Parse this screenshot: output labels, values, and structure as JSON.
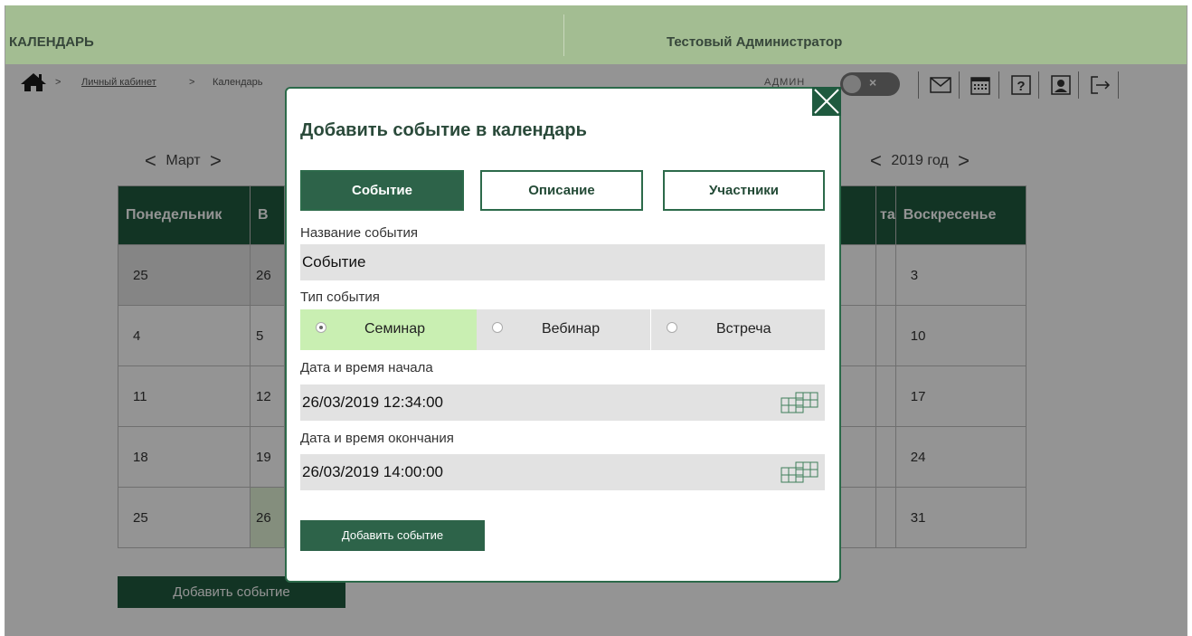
{
  "header": {
    "app_title": "КАЛЕНДАРЬ",
    "user_name": "Тестовый Администратор"
  },
  "breadcrumb": {
    "sep": ">",
    "link": "Личный кабинет",
    "current": "Календарь"
  },
  "admin_toggle": {
    "label": "АДМИН",
    "state_glyph": "×"
  },
  "toolbar_icons": [
    "home-icon",
    "mail-icon",
    "calendar-icon",
    "help-icon",
    "profile-icon",
    "logout-icon"
  ],
  "calendar": {
    "month_label": "Март",
    "year_label": "2019 год",
    "prev_glyph": "<",
    "next_glyph": ">",
    "headers": {
      "mon": "Понедельник",
      "tue_partial": "В",
      "sat_partial": "та",
      "sun": "Воскресенье"
    },
    "rows": [
      {
        "mon": "25",
        "tue": "26",
        "sun": "3"
      },
      {
        "mon": "4",
        "tue": "5",
        "sun": "10"
      },
      {
        "mon": "11",
        "tue": "12",
        "sun": "17"
      },
      {
        "mon": "18",
        "tue": "19",
        "sun": "24"
      },
      {
        "mon": "25",
        "tue": "26",
        "sun": "31"
      }
    ],
    "add_button": "Добавить событие"
  },
  "modal": {
    "title": "Добавить событие в календарь",
    "tabs": [
      {
        "label": "Событие",
        "active": true
      },
      {
        "label": "Описание",
        "active": false
      },
      {
        "label": "Участники",
        "active": false
      }
    ],
    "name_label": "Название события",
    "name_value": "Событие",
    "type_label": "Тип события",
    "type_options": [
      {
        "label": "Семинар",
        "selected": true
      },
      {
        "label": "Вебинар",
        "selected": false
      },
      {
        "label": "Встреча",
        "selected": false
      }
    ],
    "start_label": "Дата и время начала",
    "start_value": "26/03/2019 12:34:00",
    "end_label": "Дата и время окончания",
    "end_value": "26/03/2019 14:00:00",
    "submit_label": "Добавить событие"
  },
  "colors": {
    "header_bg": "#a3bd92",
    "primary": "#2d6349",
    "selected_option": "#c9efb2",
    "field_bg": "#e2e2e2"
  }
}
